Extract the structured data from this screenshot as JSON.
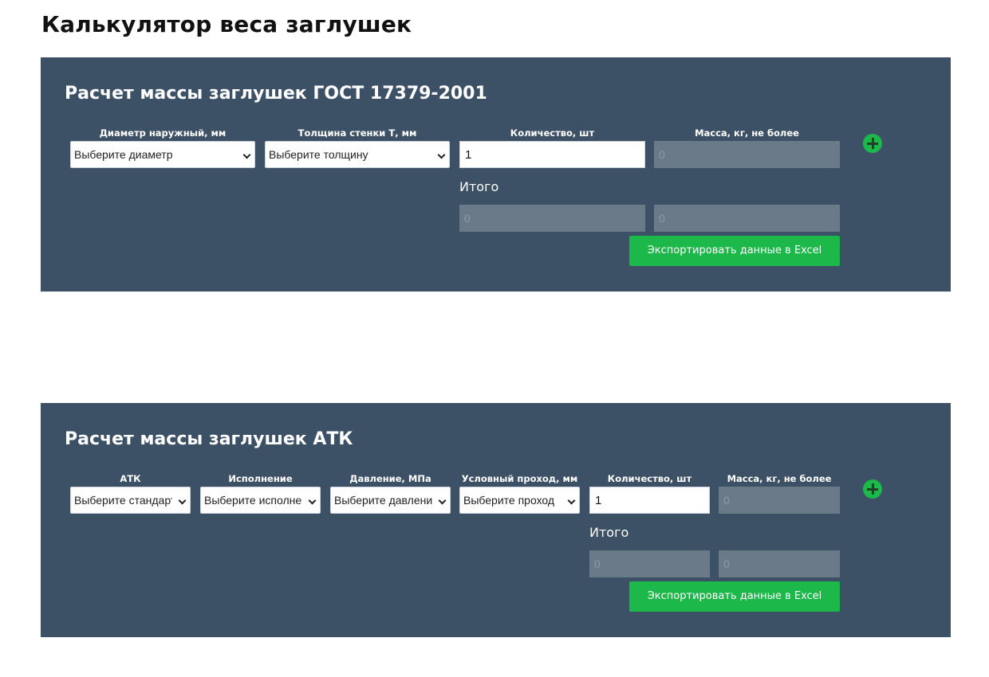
{
  "page": {
    "title": "Калькулятор веса заглушек"
  },
  "colors": {
    "panel_bg": "#3c5066",
    "accent_green": "#1db84a",
    "disabled_field": "#6b7a89"
  },
  "gost": {
    "title": "Расчет массы заглушек ГОСТ 17379-2001",
    "labels": {
      "diameter": "Диаметр наружный, мм",
      "thickness": "Толщина стенки Т, мм",
      "quantity": "Количество, шт",
      "mass": "Масса, кг, не более"
    },
    "diameter_select": "Выберите диаметр",
    "thickness_select": "Выберите толщину",
    "quantity_value": "1",
    "mass_placeholder": "0",
    "itogo_label": "Итого",
    "total_quantity": "0",
    "total_mass": "0",
    "export_label": "Экспортировать данные в Excel",
    "add_icon": "plus-circle-icon"
  },
  "atk": {
    "title": "Расчет массы заглушек АТК",
    "labels": {
      "standard": "АТК",
      "execution": "Исполнение",
      "pressure": "Давление, МПа",
      "passage": "Условный проход, мм",
      "quantity": "Количество, шт",
      "mass": "Масса, кг, не более"
    },
    "standard_select": "Выберите стандарт",
    "execution_select": "Выберите исполнение",
    "pressure_select": "Выберите давление",
    "passage_select": "Выберите проход",
    "quantity_value": "1",
    "mass_placeholder": "0",
    "itogo_label": "Итого",
    "total_quantity": "0",
    "total_mass": "0",
    "export_label": "Экспортировать данные в Excel",
    "add_icon": "plus-circle-icon"
  }
}
